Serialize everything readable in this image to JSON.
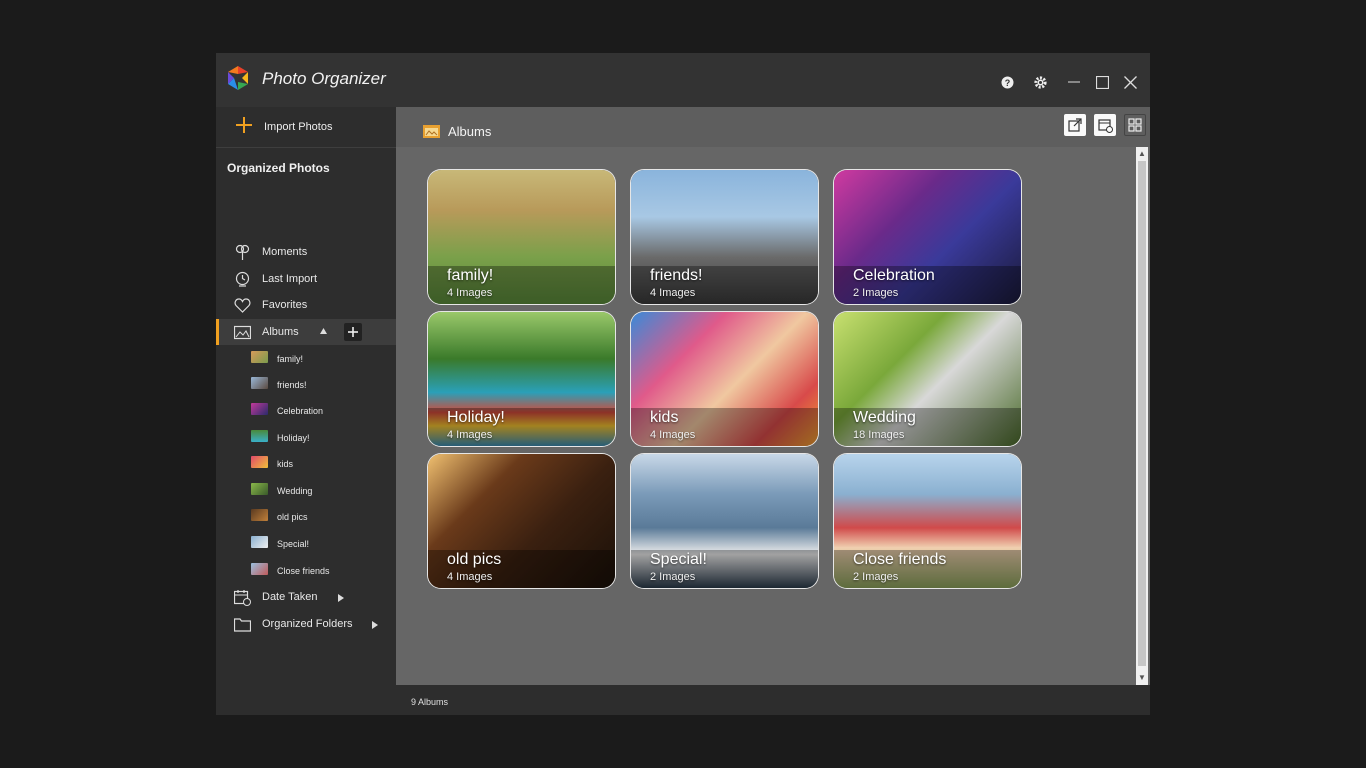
{
  "app": {
    "title": "Photo Organizer"
  },
  "sidebar": {
    "import_label": "Import Photos",
    "section_title": "Organized Photos",
    "nav": [
      {
        "label": "Moments",
        "icon": "moments-icon"
      },
      {
        "label": "Last Import",
        "icon": "last-import-icon"
      },
      {
        "label": "Favorites",
        "icon": "heart-icon"
      },
      {
        "label": "Albums",
        "icon": "albums-icon"
      }
    ],
    "albums": [
      {
        "label": "family!"
      },
      {
        "label": "friends!"
      },
      {
        "label": "Celebration"
      },
      {
        "label": "Holiday!"
      },
      {
        "label": "kids"
      },
      {
        "label": "Wedding"
      },
      {
        "label": "old pics"
      },
      {
        "label": "Special!"
      },
      {
        "label": "Close friends"
      }
    ],
    "bottom": [
      {
        "label": "Date Taken",
        "icon": "calendar-icon"
      },
      {
        "label": "Organized Folders",
        "icon": "folder-icon"
      }
    ]
  },
  "main": {
    "title": "Albums",
    "tiles": [
      {
        "name": "family!",
        "count": "4 Images"
      },
      {
        "name": "friends!",
        "count": "4 Images"
      },
      {
        "name": "Celebration",
        "count": "2 Images"
      },
      {
        "name": "Holiday!",
        "count": "4 Images"
      },
      {
        "name": "kids",
        "count": "4 Images"
      },
      {
        "name": "Wedding",
        "count": "18 Images"
      },
      {
        "name": "old pics",
        "count": "4 Images"
      },
      {
        "name": "Special!",
        "count": "2 Images"
      },
      {
        "name": "Close friends",
        "count": "2 Images"
      }
    ]
  },
  "status": {
    "text": "9 Albums"
  },
  "colors": {
    "accent": "#f0a020",
    "window_bg": "#2d2d2d",
    "content_bg": "#666666"
  }
}
